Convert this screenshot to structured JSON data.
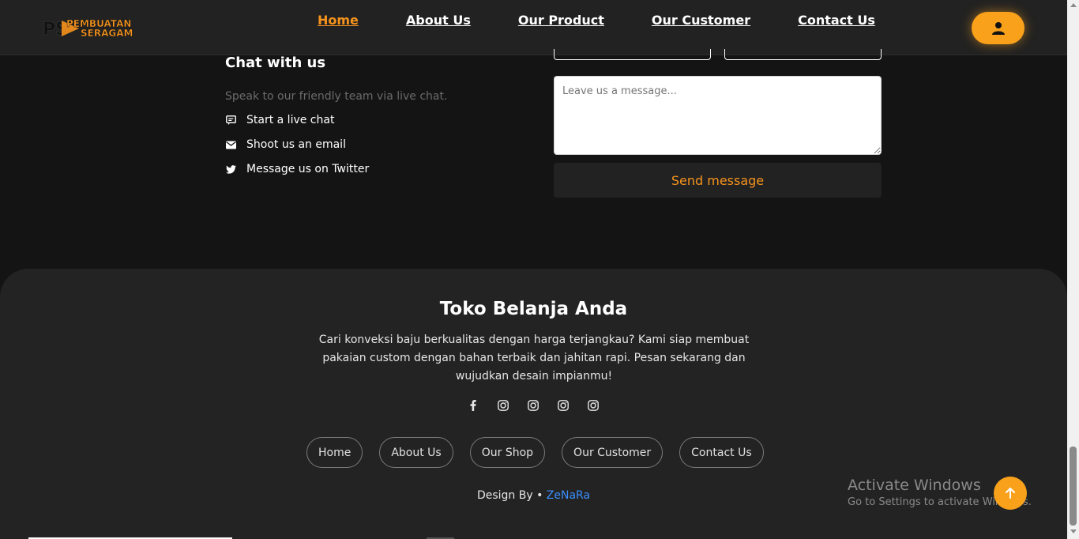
{
  "navbar": {
    "logo_text_line1": "PEMBUATAN",
    "logo_text_line2": "SERAGAM",
    "logo_initials": "PS",
    "links": [
      {
        "label": "Home",
        "active": true
      },
      {
        "label": "About Us",
        "active": false
      },
      {
        "label": "Our Product",
        "active": false
      },
      {
        "label": "Our Customer",
        "active": false
      },
      {
        "label": "Contact Us",
        "active": false
      }
    ],
    "user_icon": "user-icon"
  },
  "contact": {
    "chat_title": "Chat with us",
    "chat_subtitle": "Speak to our friendly team via live chat.",
    "options": [
      {
        "label": "Start a live chat",
        "icon": "chat-icon"
      },
      {
        "label": "Shoot us an email",
        "icon": "mail-icon"
      },
      {
        "label": "Message us on Twitter",
        "icon": "twitter-icon"
      }
    ],
    "message_placeholder": "Leave us a message...",
    "send_label": "Send message"
  },
  "footer": {
    "title": "Toko Belanja Anda",
    "description": "Cari konveksi baju berkualitas dengan harga terjangkau? Kami siap membuat pakaian custom dengan bahan terbaik dan jahitan rapi. Pesan sekarang dan wujudkan desain impianmu!",
    "socials": [
      "facebook-icon",
      "instagram-icon",
      "instagram-icon",
      "instagram-icon",
      "instagram-icon"
    ],
    "links": [
      "Home",
      "About Us",
      "Our Shop",
      "Our Customer",
      "Contact Us"
    ],
    "credit_prefix": "Design By •",
    "credit_name": "ZeNaRa"
  },
  "watermark": {
    "title": "Activate Windows",
    "subtitle": "Go to Settings to activate Windows."
  },
  "colors": {
    "accent": "#f7941d",
    "button": "#f9a11b",
    "link": "#3b8fff",
    "background": "#141414",
    "footer": "#232323"
  }
}
